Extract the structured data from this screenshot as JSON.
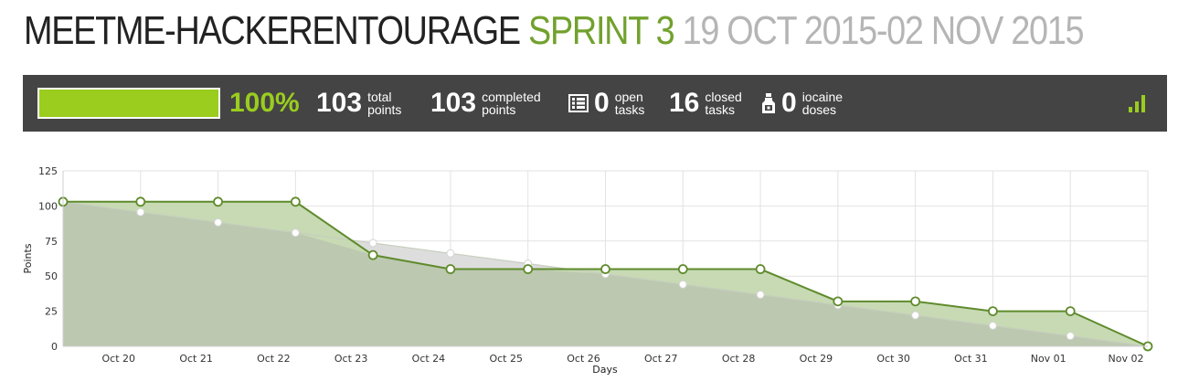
{
  "header": {
    "project": "MEETME-HACKERENTOURAGE",
    "sprint": "SPRINT 3",
    "dates": "19 OCT 2015-02 NOV 2015"
  },
  "stats": {
    "progress_fraction": 1.0,
    "percent": "100%",
    "total_points": {
      "value": "103",
      "label_top": "total",
      "label_bottom": "points"
    },
    "completed_points": {
      "value": "103",
      "label_top": "completed",
      "label_bottom": "points"
    },
    "open_tasks": {
      "value": "0",
      "label_top": "open",
      "label_bottom": "tasks",
      "icon": "task-list-icon"
    },
    "closed_tasks": {
      "value": "16",
      "label_top": "closed",
      "label_bottom": "tasks"
    },
    "iocaine_doses": {
      "value": "0",
      "label_top": "iocaine",
      "label_bottom": "doses",
      "icon": "potion-bottle-icon"
    },
    "graph_toggle_icon": "bar-graph-icon"
  },
  "colors": {
    "accent_green": "#9acd1e",
    "sprint_green": "#72a12e",
    "bar_bg": "#444444",
    "actual_line": "#5f8b2c",
    "actual_fill": "#c7dab4",
    "ideal_fill": "#bcc8b0",
    "ideal_gray_fill": "#dddddd"
  },
  "chart_data": {
    "type": "area",
    "xlabel": "Days",
    "ylabel": "Points",
    "ylim": [
      0,
      125
    ],
    "yticks": [
      0,
      25,
      50,
      75,
      100,
      125
    ],
    "grid": true,
    "x_start": "Oct 19",
    "categories": [
      "Oct 20",
      "Oct 21",
      "Oct 22",
      "Oct 23",
      "Oct 24",
      "Oct 25",
      "Oct 26",
      "Oct 27",
      "Oct 28",
      "Oct 29",
      "Oct 30",
      "Oct 31",
      "Nov 01",
      "Nov 02"
    ],
    "series": [
      {
        "role": "actual",
        "x": [
          "Oct 19",
          "Oct 20",
          "Oct 21",
          "Oct 22",
          "Oct 23",
          "Oct 24",
          "Oct 25",
          "Oct 26",
          "Oct 27",
          "Oct 28",
          "Oct 29",
          "Oct 30",
          "Oct 31",
          "Nov 01",
          "Nov 02"
        ],
        "values": [
          103,
          103,
          103,
          103,
          65,
          55,
          55,
          55,
          55,
          55,
          32,
          32,
          25,
          25,
          0
        ]
      },
      {
        "role": "ideal",
        "x": [
          "Oct 19",
          "Oct 20",
          "Oct 21",
          "Oct 22",
          "Oct 23",
          "Oct 24",
          "Oct 25",
          "Oct 26",
          "Oct 27",
          "Oct 28",
          "Oct 29",
          "Oct 30",
          "Oct 31",
          "Nov 01",
          "Nov 02"
        ],
        "values": [
          103,
          95.6,
          88.3,
          80.9,
          73.6,
          66.2,
          58.9,
          51.5,
          44.1,
          36.8,
          29.4,
          22.1,
          14.7,
          7.4,
          0
        ]
      }
    ]
  }
}
